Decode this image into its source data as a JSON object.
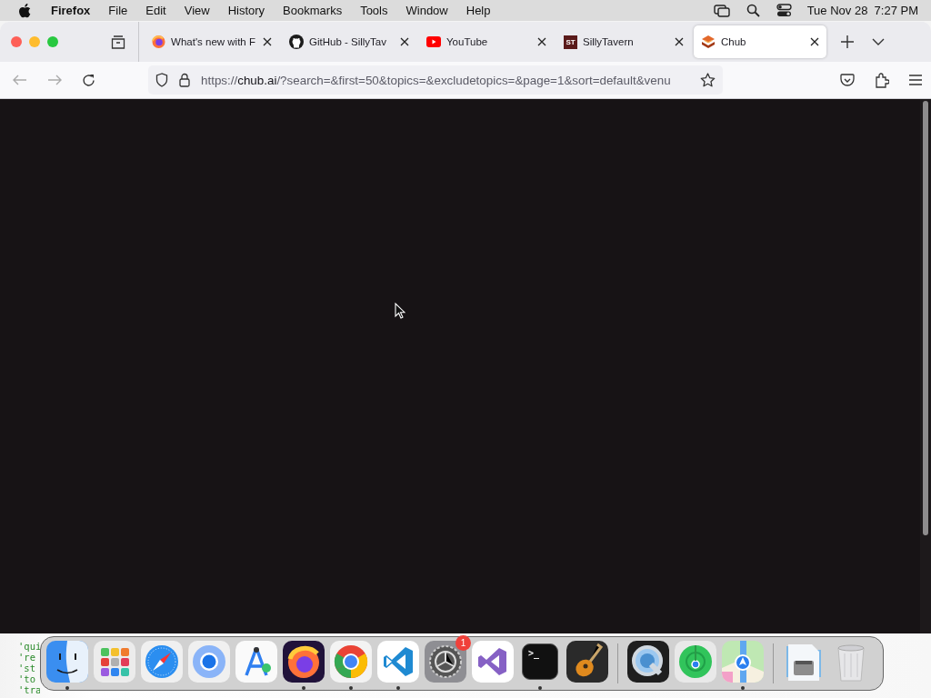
{
  "menu_bar": {
    "app_name": "Firefox",
    "menus": [
      "File",
      "Edit",
      "View",
      "History",
      "Bookmarks",
      "Tools",
      "Window",
      "Help"
    ],
    "clock": "Tue Nov 28  7:27 PM"
  },
  "browser": {
    "tabs": [
      {
        "kind": "firefox",
        "label": "What's new with F",
        "selected": false
      },
      {
        "kind": "github",
        "label": "GitHub - SillyTav",
        "selected": false
      },
      {
        "kind": "youtube",
        "label": "YouTube",
        "selected": false
      },
      {
        "kind": "monogram",
        "icon_text": "ST",
        "label": "SillyTavern",
        "selected": false
      },
      {
        "kind": "chub",
        "label": "Chub",
        "selected": true
      }
    ],
    "url": "https://**chub.ai**/?search=&first=50&topics=&excludetopics=&page=1&sort=default&venu"
  },
  "background_text": [
    "'qui",
    "'re",
    "'st",
    "'to",
    "'tra"
  ],
  "dock": {
    "groups": [
      [
        {
          "kind": "finder",
          "running": true
        },
        {
          "kind": "launchpad",
          "running": false
        },
        {
          "kind": "safari",
          "running": false
        },
        {
          "kind": "chromium",
          "running": false
        },
        {
          "kind": "compass-a",
          "running": false
        },
        {
          "kind": "firefox",
          "running": true
        },
        {
          "kind": "chrome",
          "running": true
        },
        {
          "kind": "vscode",
          "running": true
        },
        {
          "kind": "settings",
          "running": false,
          "badge": "1"
        },
        {
          "kind": "vstudio",
          "running": false
        },
        {
          "kind": "terminal",
          "running": true,
          "icon_text": ">_"
        },
        {
          "kind": "guitar",
          "running": false
        }
      ],
      [
        {
          "kind": "quicktime",
          "running": false
        },
        {
          "kind": "findmy",
          "running": false
        },
        {
          "kind": "maps",
          "running": true
        }
      ],
      [
        {
          "kind": "downloads",
          "running": false
        },
        {
          "kind": "trash",
          "running": false
        }
      ]
    ]
  }
}
